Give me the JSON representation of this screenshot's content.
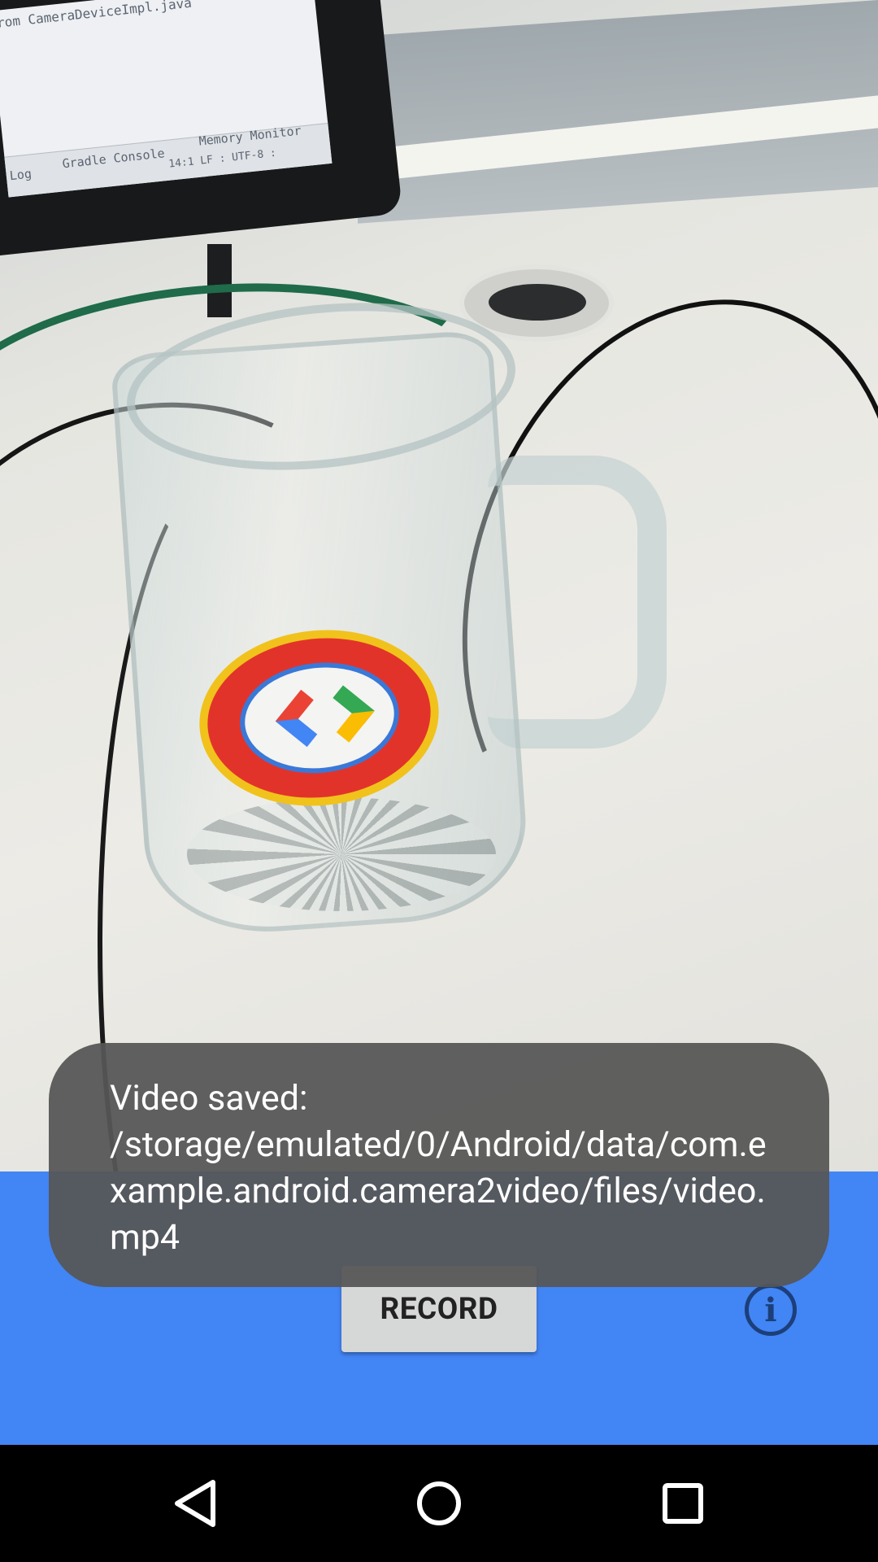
{
  "preview": {
    "monitor_text": {
      "line1": "rom CameraDeviceImpl.java",
      "log": "Log",
      "gradle": "Gradle Console",
      "memory": "Memory Monitor",
      "status": "14:1  LF :  UTF-8 :"
    }
  },
  "toast": {
    "message": "Video saved: /storage/emulated/0/Android/data/com.example.android.camera2video/files/video.mp4"
  },
  "controls": {
    "record_label": "RECORD",
    "info_icon": "info-icon"
  },
  "navigation": {
    "back_icon": "back-icon",
    "home_icon": "home-icon",
    "recents_icon": "recents-icon"
  },
  "colors": {
    "control_bar": "#4285f4",
    "record_button": "#d6d7d7",
    "info_icon": "#1c3f7a",
    "toast_bg": "#565656"
  }
}
